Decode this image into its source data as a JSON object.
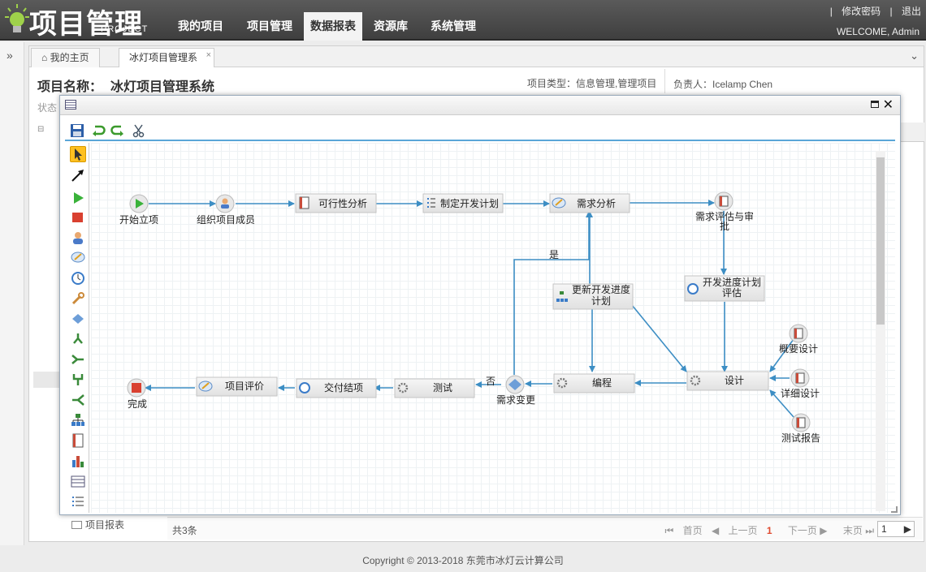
{
  "header": {
    "logo_text": "项目管理",
    "logo_sub": "PROJECT",
    "nav": [
      "我的项目",
      "项目管理",
      "数据报表",
      "资源库",
      "系统管理"
    ],
    "active_nav": "数据报表",
    "links": [
      "修改密码",
      "退出"
    ],
    "welcome": "WELCOME, Admin"
  },
  "tabs": [
    {
      "label": "我的主页",
      "icon": "home-icon"
    },
    {
      "label": "冰灯项目管理系",
      "closable": true
    }
  ],
  "project": {
    "name_label": "项目名称：",
    "name": "冰灯项目管理系统",
    "type": "项目类型：信息管理,管理项目",
    "owner": "负责人：Icelamp Chen",
    "status_label": "状态"
  },
  "list": {
    "report_item": "项目报表",
    "count": "共3条",
    "pager": {
      "first": "首页",
      "prev": "上一页",
      "current": "1",
      "next": "下一页",
      "last": "末页"
    },
    "page_input": "1"
  },
  "footer": "Copyright © 2013-2018 东莞市冰灯云计算公司",
  "flow": {
    "nodes": {
      "start": "开始立项",
      "team": "组织项目成员",
      "feasibility": "可行性分析",
      "plan": "制定开发计划",
      "requirement": "需求分析",
      "review1": "需求评估与审",
      "review2": "批",
      "schedule1": "开发进度计划",
      "schedule2": "评估",
      "update1": "更新开发进度",
      "update2": "计划",
      "outline": "概要设计",
      "detail": "详细设计",
      "testreport": "测试报告",
      "design": "设计",
      "coding": "编程",
      "change": "需求变更",
      "test": "测试",
      "delivery": "交付结项",
      "evaluation": "项目评价",
      "done": "完成"
    },
    "labels": {
      "yes": "是",
      "no": "否"
    }
  },
  "colors": {
    "accent": "#5aa6d8",
    "arrow": "#3d8ec4",
    "node_fill": "#ececec",
    "active_red": "#e04a2f"
  }
}
